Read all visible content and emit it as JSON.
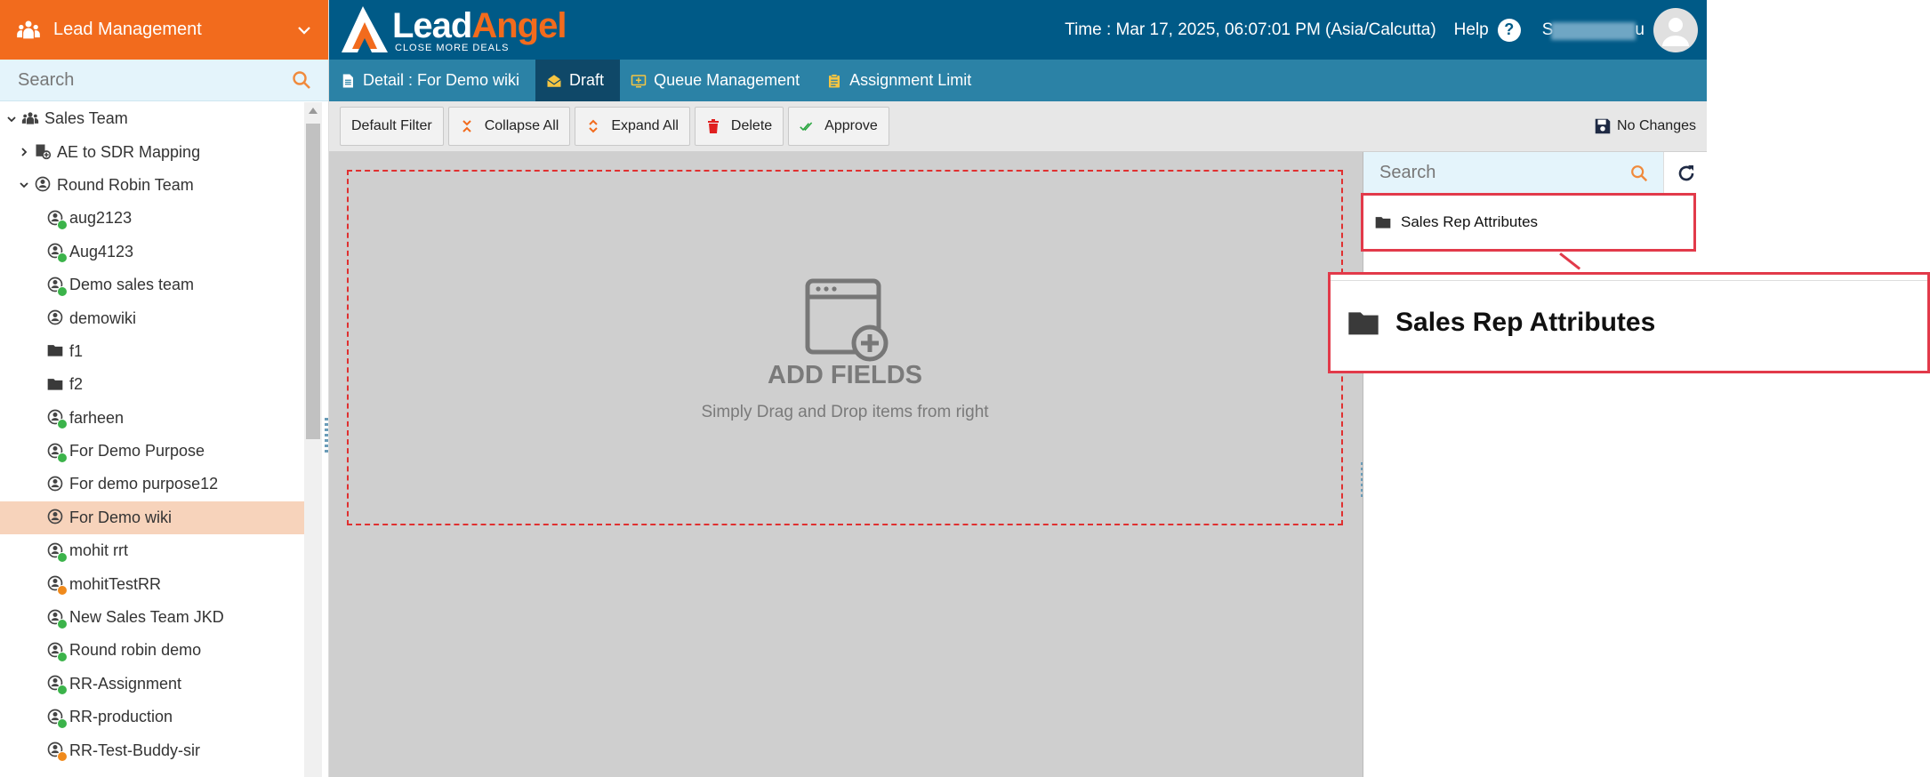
{
  "sidebar": {
    "title": "Lead Management",
    "search_placeholder": "Search",
    "tree": [
      {
        "label": "Sales Team",
        "indent": 0,
        "twisty": "down",
        "icon": "team-icon",
        "badge": ""
      },
      {
        "label": "AE to SDR Mapping",
        "indent": 1,
        "twisty": "right",
        "icon": "mapping-icon",
        "badge": ""
      },
      {
        "label": "Round Robin Team",
        "indent": 1,
        "twisty": "down",
        "icon": "round-robin-icon",
        "badge": ""
      },
      {
        "label": "aug2123",
        "indent": 2,
        "twisty": "",
        "icon": "round-robin-icon",
        "badge": "ok"
      },
      {
        "label": "Aug4123",
        "indent": 2,
        "twisty": "",
        "icon": "round-robin-icon",
        "badge": "ok"
      },
      {
        "label": "Demo sales team",
        "indent": 2,
        "twisty": "",
        "icon": "round-robin-icon",
        "badge": "ok"
      },
      {
        "label": "demowiki",
        "indent": 2,
        "twisty": "",
        "icon": "round-robin-icon",
        "badge": ""
      },
      {
        "label": "f1",
        "indent": 2,
        "twisty": "",
        "icon": "folder-icon",
        "badge": ""
      },
      {
        "label": "f2",
        "indent": 2,
        "twisty": "",
        "icon": "folder-icon",
        "badge": ""
      },
      {
        "label": "farheen",
        "indent": 2,
        "twisty": "",
        "icon": "round-robin-icon",
        "badge": "ok"
      },
      {
        "label": "For Demo Purpose",
        "indent": 2,
        "twisty": "",
        "icon": "round-robin-icon",
        "badge": "ok"
      },
      {
        "label": "For demo purpose12",
        "indent": 2,
        "twisty": "",
        "icon": "round-robin-icon",
        "badge": ""
      },
      {
        "label": "For Demo wiki",
        "indent": 2,
        "twisty": "",
        "icon": "round-robin-icon",
        "badge": "",
        "selected": true
      },
      {
        "label": "mohit rrt",
        "indent": 2,
        "twisty": "",
        "icon": "round-robin-icon",
        "badge": "ok"
      },
      {
        "label": "mohitTestRR",
        "indent": 2,
        "twisty": "",
        "icon": "round-robin-icon",
        "badge": "warn"
      },
      {
        "label": "New Sales Team JKD",
        "indent": 2,
        "twisty": "",
        "icon": "round-robin-icon",
        "badge": "ok"
      },
      {
        "label": "Round robin demo",
        "indent": 2,
        "twisty": "",
        "icon": "round-robin-icon",
        "badge": "ok"
      },
      {
        "label": "RR-Assignment",
        "indent": 2,
        "twisty": "",
        "icon": "round-robin-icon",
        "badge": "ok"
      },
      {
        "label": "RR-production",
        "indent": 2,
        "twisty": "",
        "icon": "round-robin-icon",
        "badge": "ok"
      },
      {
        "label": "RR-Test-Buddy-sir",
        "indent": 2,
        "twisty": "",
        "icon": "round-robin-icon",
        "badge": "warn"
      }
    ]
  },
  "header": {
    "brand_lead": "Lead",
    "brand_angel": "Angel",
    "tagline": "CLOSE MORE DEALS",
    "time": "Time : Mar 17, 2025, 06:07:01 PM (Asia/Calcutta)",
    "help_label": "Help",
    "user_first": "S",
    "user_last": "u"
  },
  "tabs": [
    {
      "label": "Detail : For Demo wiki",
      "icon": "document-icon",
      "active": false
    },
    {
      "label": "Draft",
      "icon": "envelope-open-icon",
      "active": true
    },
    {
      "label": "Queue Management",
      "icon": "queue-icon",
      "active": false
    },
    {
      "label": "Assignment Limit",
      "icon": "clipboard-icon",
      "active": false
    }
  ],
  "toolbar": {
    "default_filter": "Default Filter",
    "collapse_all": "Collapse All",
    "expand_all": "Expand All",
    "delete": "Delete",
    "approve": "Approve",
    "status": "No Changes"
  },
  "canvas": {
    "title": "ADD FIELDS",
    "subtitle": "Simply Drag and Drop items from right"
  },
  "right_pane": {
    "search_placeholder": "Search",
    "item_label": "Sales Rep Attributes"
  },
  "callout": {
    "label": "Sales Rep Attributes"
  },
  "colors": {
    "brand_orange": "#f26b1d",
    "header_blue": "#005a87",
    "tab_blue": "#2b82a6",
    "active_tab": "#0f4868",
    "highlight_red": "#e23a4a",
    "selected_row": "#f7d3bb"
  }
}
